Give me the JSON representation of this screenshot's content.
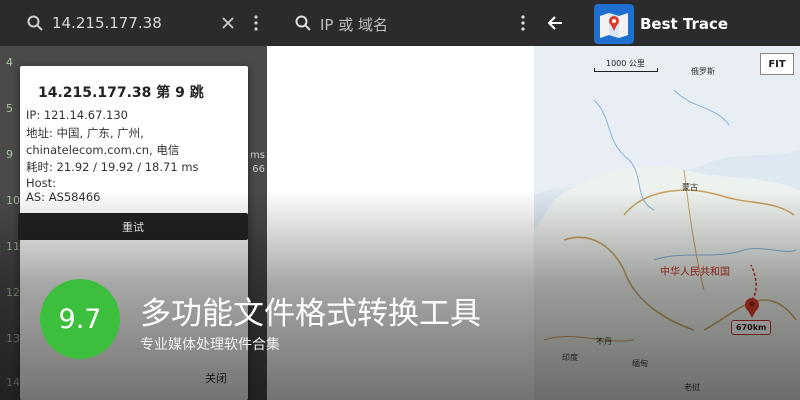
{
  "left_panel": {
    "search_value": "14.215.177.38",
    "hop_numbers": [
      "4",
      "5",
      "9",
      "10",
      "11",
      "12",
      "13",
      "14"
    ],
    "side_texts": [
      "ms",
      "66"
    ],
    "dialog": {
      "title": "14.215.177.38 第 9 跳",
      "ip": "IP: 121.14.67.130",
      "address": "地址: 中国, 广东, 广州,",
      "isp": "chinatelecom.com.cn, 电信",
      "rtt": "耗时: 21.92 / 19.92 / 18.71 ms",
      "host": "Host:",
      "as": "AS: AS58466",
      "retry_label": "重试",
      "close_label": "关闭"
    }
  },
  "middle_panel": {
    "search_placeholder": "IP 或 域名"
  },
  "right_panel": {
    "app_title": "Best Trace",
    "fit_label": "FIT",
    "scale_label": "1000 公里",
    "map_labels": {
      "russia": "俄罗斯",
      "mongolia": "蒙古",
      "china": "中华人民共和国",
      "india": "印度",
      "myanmar": "缅甸",
      "laos": "老挝",
      "bhutan": "不丹"
    },
    "distance": "670km"
  },
  "overlay": {
    "score": "9.7",
    "headline": "多功能文件格式转换工具",
    "subline": "专业媒体处理软件合集"
  },
  "colors": {
    "score_green": "#3cbf3c",
    "toolbar": "#2b2b2b",
    "route_red": "#c03020"
  }
}
